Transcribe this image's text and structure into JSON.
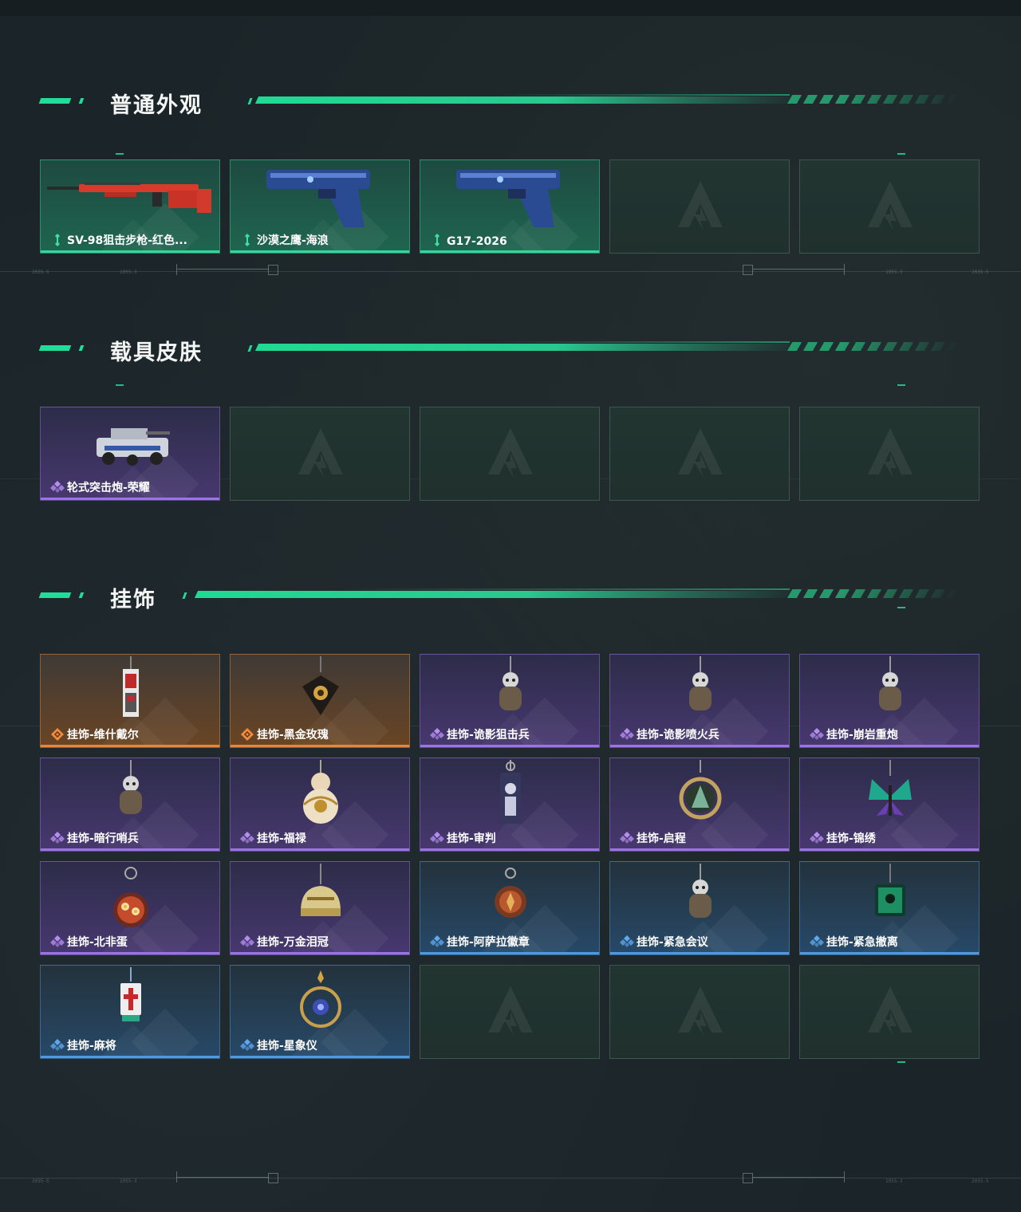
{
  "sections": {
    "normal": {
      "title": "普通外观",
      "items": [
        {
          "name": "SV-98狙击步枪-红色...",
          "rarity": "green",
          "icon": "sniper-rifle-icon"
        },
        {
          "name": "沙漠之鹰-海浪",
          "rarity": "green",
          "icon": "pistol-icon"
        },
        {
          "name": "G17-2026",
          "rarity": "green",
          "icon": "pistol-icon"
        }
      ]
    },
    "vehicle": {
      "title": "载具皮肤",
      "items": [
        {
          "name": "轮式突击炮-荣耀",
          "rarity": "purple",
          "icon": "armored-vehicle-icon"
        }
      ]
    },
    "pendant": {
      "title": "挂饰",
      "items": [
        {
          "name": "挂饰-维什戴尔",
          "rarity": "orange",
          "icon": "tag-pendant-icon"
        },
        {
          "name": "挂饰-黑金玫瑰",
          "rarity": "orange",
          "icon": "rose-pendant-icon"
        },
        {
          "name": "挂饰-诡影狙击兵",
          "rarity": "purple",
          "icon": "figure-pendant-icon"
        },
        {
          "name": "挂饰-诡影喷火兵",
          "rarity": "purple",
          "icon": "figure-pendant-icon"
        },
        {
          "name": "挂饰-崩岩重炮",
          "rarity": "purple",
          "icon": "figure-pendant-icon"
        },
        {
          "name": "挂饰-暗行哨兵",
          "rarity": "purple",
          "icon": "figure-pendant-icon"
        },
        {
          "name": "挂饰-福禄",
          "rarity": "purple",
          "icon": "gourd-pendant-icon"
        },
        {
          "name": "挂饰-审判",
          "rarity": "purple",
          "icon": "card-pendant-icon"
        },
        {
          "name": "挂饰-启程",
          "rarity": "purple",
          "icon": "ring-pendant-icon"
        },
        {
          "name": "挂饰-锦绣",
          "rarity": "purple",
          "icon": "butterfly-pendant-icon"
        },
        {
          "name": "挂饰-北非蛋",
          "rarity": "purple",
          "icon": "dish-pendant-icon"
        },
        {
          "name": "挂饰-万金泪冠",
          "rarity": "purple",
          "icon": "dome-pendant-icon"
        },
        {
          "name": "挂饰-阿萨拉徽章",
          "rarity": "blue",
          "icon": "badge-pendant-icon"
        },
        {
          "name": "挂饰-紧急会议",
          "rarity": "blue",
          "icon": "figure-pendant-icon"
        },
        {
          "name": "挂饰-紧急撤离",
          "rarity": "blue",
          "icon": "cube-pendant-icon"
        },
        {
          "name": "挂饰-麻将",
          "rarity": "blue",
          "icon": "mahjong-pendant-icon"
        },
        {
          "name": "挂饰-星象仪",
          "rarity": "blue",
          "icon": "astrolabe-pendant-icon"
        }
      ]
    }
  },
  "frame": {
    "coords": [
      "2035-5",
      "1955-3",
      "1955-3",
      "2035-5"
    ]
  },
  "colors": {
    "accent": "#22dd9a",
    "green": "#33d79c",
    "purple": "#9d72e6",
    "orange": "#e6853b",
    "blue": "#4e9ae2"
  }
}
